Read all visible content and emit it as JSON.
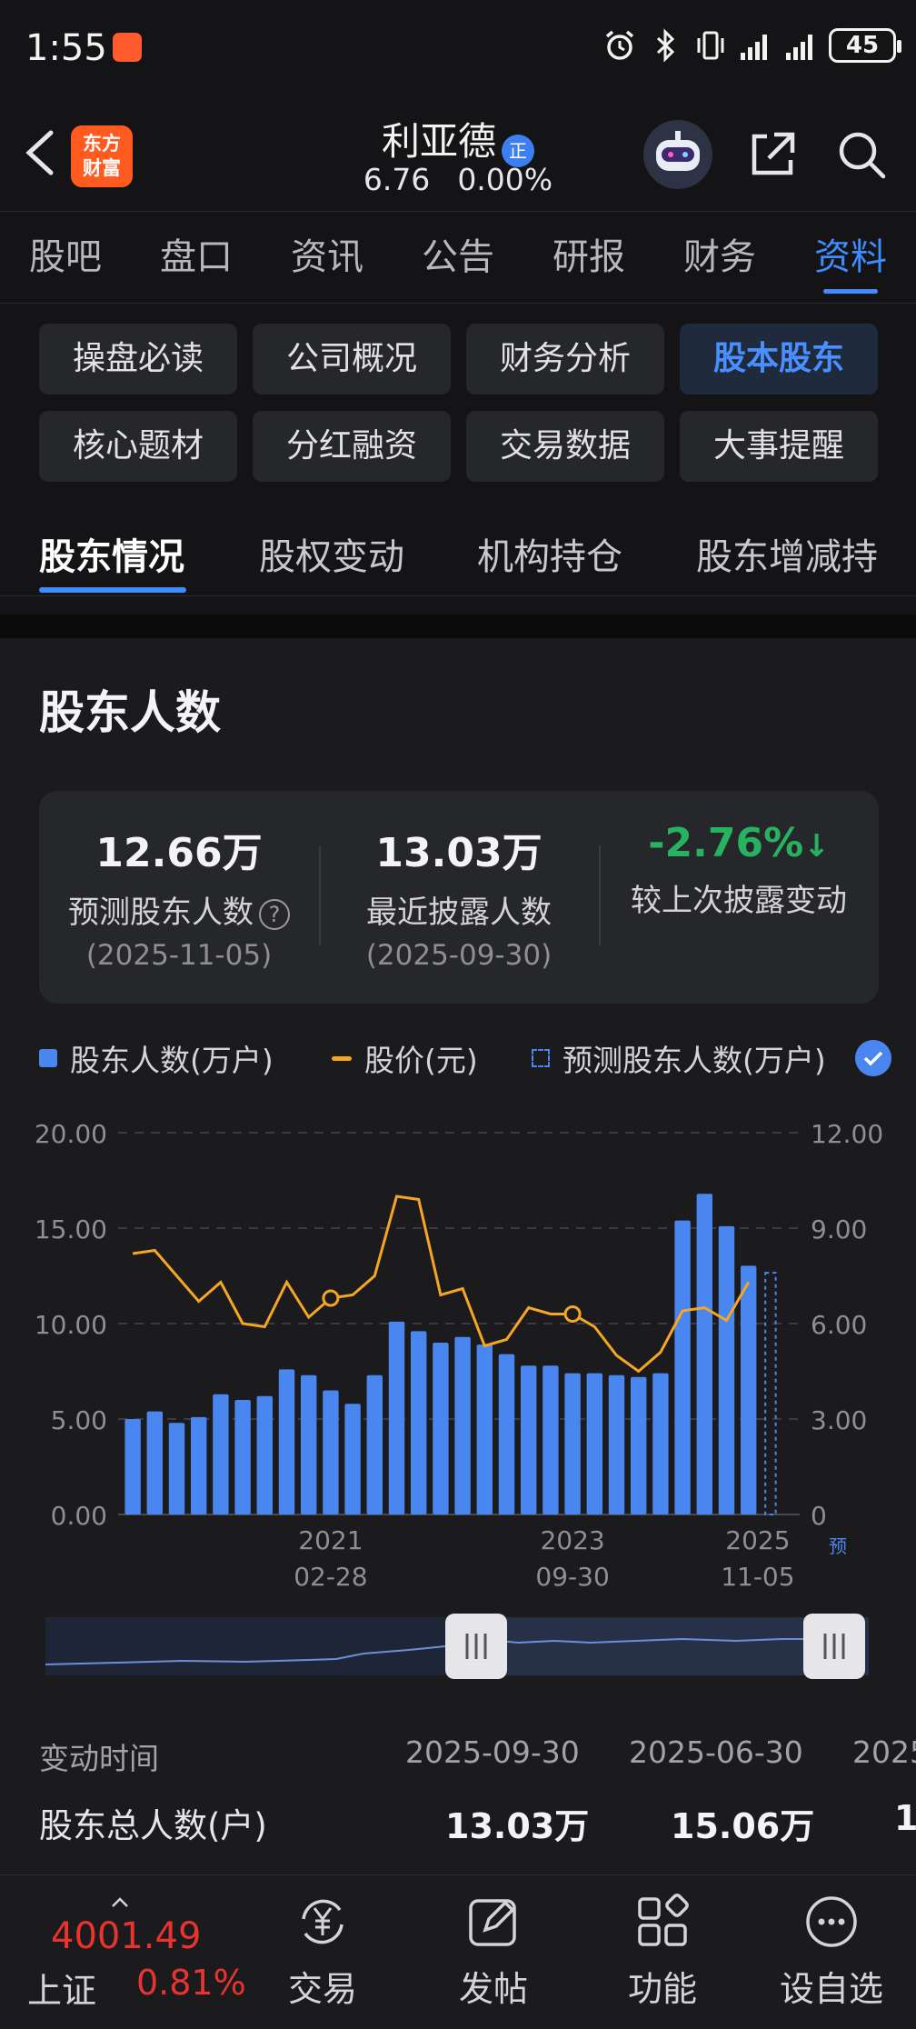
{
  "status_bar": {
    "time": "1:55",
    "battery": "45"
  },
  "header": {
    "brand_line1": "东方",
    "brand_line2": "财富",
    "stock_name": "利亚德",
    "badge": "正",
    "price": "6.76",
    "change": "0.00%"
  },
  "main_tabs": [
    "股吧",
    "盘口",
    "资讯",
    "公告",
    "研报",
    "财务",
    "资料"
  ],
  "main_tab_active": "资料",
  "sub_buttons": [
    "操盘必读",
    "公司概况",
    "财务分析",
    "股本股东",
    "核心题材",
    "分红融资",
    "交易数据",
    "大事提醒"
  ],
  "sub_button_active": "股本股东",
  "section_tabs": [
    "股东情况",
    "股权变动",
    "机构持仓",
    "股东增减持"
  ],
  "section_title": "股东人数",
  "stats": {
    "predicted": {
      "value": "12.66万",
      "label": "预测股东人数",
      "help": "?",
      "date": "(2025-11-05)"
    },
    "latest": {
      "value": "13.03万",
      "label": "最近披露人数",
      "date": "(2025-09-30)"
    },
    "change": {
      "value": "-2.76%",
      "arrow": "↓",
      "label": "较上次披露变动"
    }
  },
  "legend": {
    "holders": "股东人数(万户)",
    "price": "股价(元)",
    "predicted": "预测股东人数(万户)"
  },
  "colors": {
    "bar": "#4a86f0",
    "price_line": "#f5a623",
    "accent": "#3f8cff",
    "up": "#e8332e",
    "down": "#27b25f"
  },
  "chart_data": {
    "type": "bar",
    "left_axis": {
      "ticks": [
        "20.00",
        "15.00",
        "10.00",
        "5.00",
        "0.00"
      ],
      "range": [
        0,
        20
      ]
    },
    "right_axis": {
      "ticks": [
        "12.00",
        "9.00",
        "6.00",
        "3.00",
        "0"
      ],
      "range": [
        0,
        12
      ]
    },
    "x_labels": [
      {
        "year": "2021",
        "date": "02-28"
      },
      {
        "year": "2023",
        "date": "09-30"
      },
      {
        "year": "2025",
        "date": "11-05"
      }
    ],
    "predicted_tag": "预",
    "series": [
      {
        "name": "股东人数(万户)",
        "values": [
          5.0,
          5.4,
          4.8,
          5.1,
          6.3,
          6.0,
          6.2,
          7.6,
          7.3,
          6.5,
          5.8,
          7.3,
          10.1,
          9.6,
          9.0,
          9.3,
          8.9,
          8.4,
          7.8,
          7.8,
          7.4,
          7.4,
          7.3,
          7.2,
          7.4,
          15.4,
          16.8,
          15.1,
          13.03
        ]
      },
      {
        "name": "股价(元)",
        "values": [
          8.2,
          8.3,
          7.5,
          6.7,
          7.3,
          6.0,
          5.9,
          7.3,
          6.2,
          6.8,
          6.9,
          7.5,
          10.0,
          9.9,
          6.9,
          7.1,
          5.3,
          5.5,
          6.5,
          6.3,
          6.3,
          5.9,
          5.0,
          4.5,
          5.1,
          6.4,
          6.5,
          6.1,
          7.3
        ]
      },
      {
        "name": "预测股东人数(万户)",
        "values": [
          12.66
        ]
      }
    ]
  },
  "table": {
    "header_label": "变动时间",
    "dates": [
      "2025-09-30",
      "2025-06-30",
      "2025"
    ],
    "row_label": "股东总人数(户)",
    "values": [
      "13.03万",
      "15.06万",
      "1"
    ]
  },
  "bottom_nav": {
    "index_value": "4001.49",
    "index_name": "上证",
    "index_change": "0.81%",
    "items": [
      "交易",
      "发帖",
      "功能",
      "设自选"
    ]
  }
}
